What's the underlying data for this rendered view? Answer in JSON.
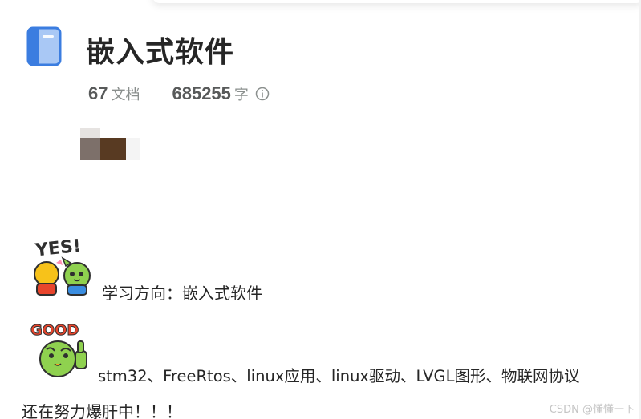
{
  "book": {
    "title": "嵌入式软件",
    "doc_count": "67",
    "doc_unit": "文档",
    "word_count": "685255",
    "word_unit": "字"
  },
  "description": {
    "direction_text": "学习方向：嵌入式软件",
    "tech_text": "stm32、FreeRtos、linux应用、linux驱动、LVGL图形、物联网协议",
    "effort_text": "还在努力爆肝中！！！",
    "sticker_yes_text": "YES!",
    "sticker_good_text": "GOOD"
  },
  "watermark": "CSDN @懂懂一下",
  "colors": {
    "book_blue": "#3b7de0",
    "text_dark": "#262626",
    "stat_gray": "#585a5a"
  },
  "icons": {
    "book": "book-icon",
    "info": "info-icon"
  }
}
